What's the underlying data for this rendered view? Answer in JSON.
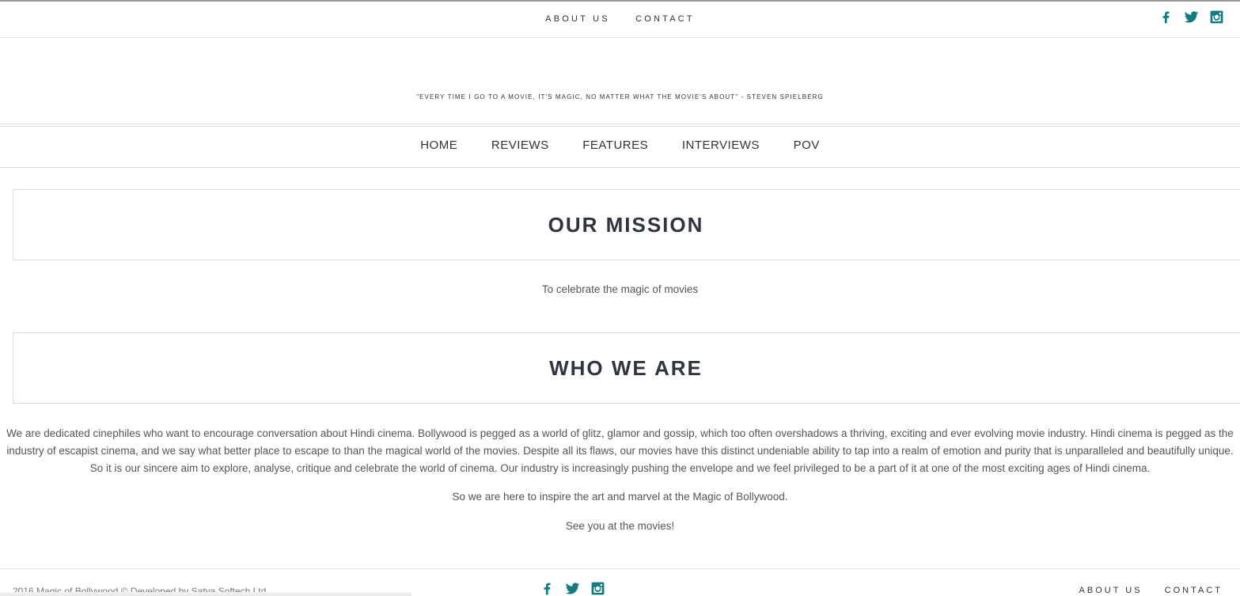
{
  "top_nav": {
    "links": [
      "ABOUT US",
      "CONTACT"
    ]
  },
  "social_icons": [
    "facebook-icon",
    "twitter-icon",
    "instagram-icon"
  ],
  "brand_color": "#137a82",
  "quote": "\"EVERY TIME I GO TO A MOVIE, IT'S MAGIC, NO MATTER WHAT THE MOVIE'S ABOUT\" - STEVEN SPIELBERG",
  "main_nav": {
    "items": [
      "HOME",
      "REVIEWS",
      "FEATURES",
      "INTERVIEWS",
      "POV"
    ]
  },
  "mission": {
    "heading": "OUR MISSION",
    "text": "To celebrate the magic of movies"
  },
  "who_we_are": {
    "heading": "WHO WE ARE",
    "paragraph": "We are dedicated cinephiles who want to encourage conversation about Hindi cinema. Bollywood is pegged as a world of glitz, glamor and gossip, which too often overshadows a thriving, exciting and ever evolving movie industry. Hindi cinema is pegged as the industry of escapist cinema, and we say what better place to escape to than the magical world of the movies. Despite all its flaws, our movies have this distinct undeniable ability to tap into a realm of emotion and purity that is unparalleled and beautifully unique. So it is our sincere aim to explore, analyse, critique and celebrate the world of cinema. Our industry is increasingly pushing the envelope and we feel privileged to be a part of it at one of the most exciting ages of Hindi cinema.",
    "line2": "So we are here to inspire the art and marvel at the Magic of Bollywood.",
    "line3": "See you at the movies!"
  },
  "footer": {
    "copyright": "2016 Magic of Bollywood  ©  Developed by Satya Softech Ltd.",
    "links": [
      "ABOUT US",
      "CONTACT"
    ]
  }
}
